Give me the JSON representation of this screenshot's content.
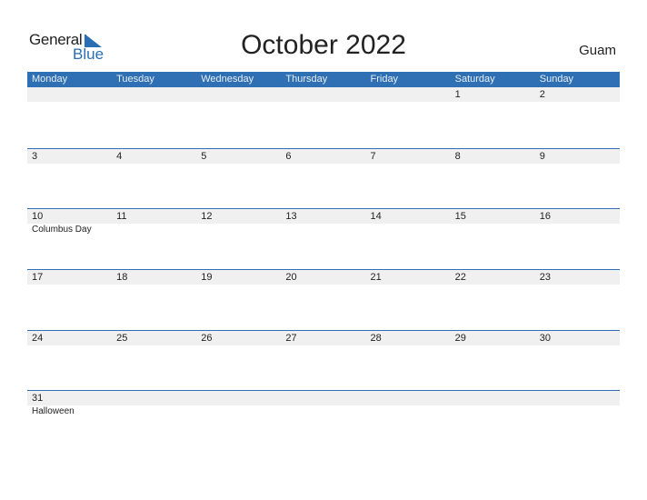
{
  "logo": {
    "general": "General",
    "blue": "Blue"
  },
  "title": "October 2022",
  "country": "Guam",
  "colors": {
    "header_bg": "#2e70b3",
    "date_strip": "#f0f0f0",
    "brand_blue": "#2a6eb4"
  },
  "weekdays": [
    "Monday",
    "Tuesday",
    "Wednesday",
    "Thursday",
    "Friday",
    "Saturday",
    "Sunday"
  ],
  "weeks": [
    {
      "days": [
        "",
        "",
        "",
        "",
        "",
        "1",
        "2"
      ],
      "holiday": ""
    },
    {
      "days": [
        "3",
        "4",
        "5",
        "6",
        "7",
        "8",
        "9"
      ],
      "holiday": ""
    },
    {
      "days": [
        "10",
        "11",
        "12",
        "13",
        "14",
        "15",
        "16"
      ],
      "holiday": "Columbus Day"
    },
    {
      "days": [
        "17",
        "18",
        "19",
        "20",
        "21",
        "22",
        "23"
      ],
      "holiday": ""
    },
    {
      "days": [
        "24",
        "25",
        "26",
        "27",
        "28",
        "29",
        "30"
      ],
      "holiday": ""
    },
    {
      "days": [
        "31",
        "",
        "",
        "",
        "",
        "",
        ""
      ],
      "holiday": "Halloween"
    }
  ]
}
